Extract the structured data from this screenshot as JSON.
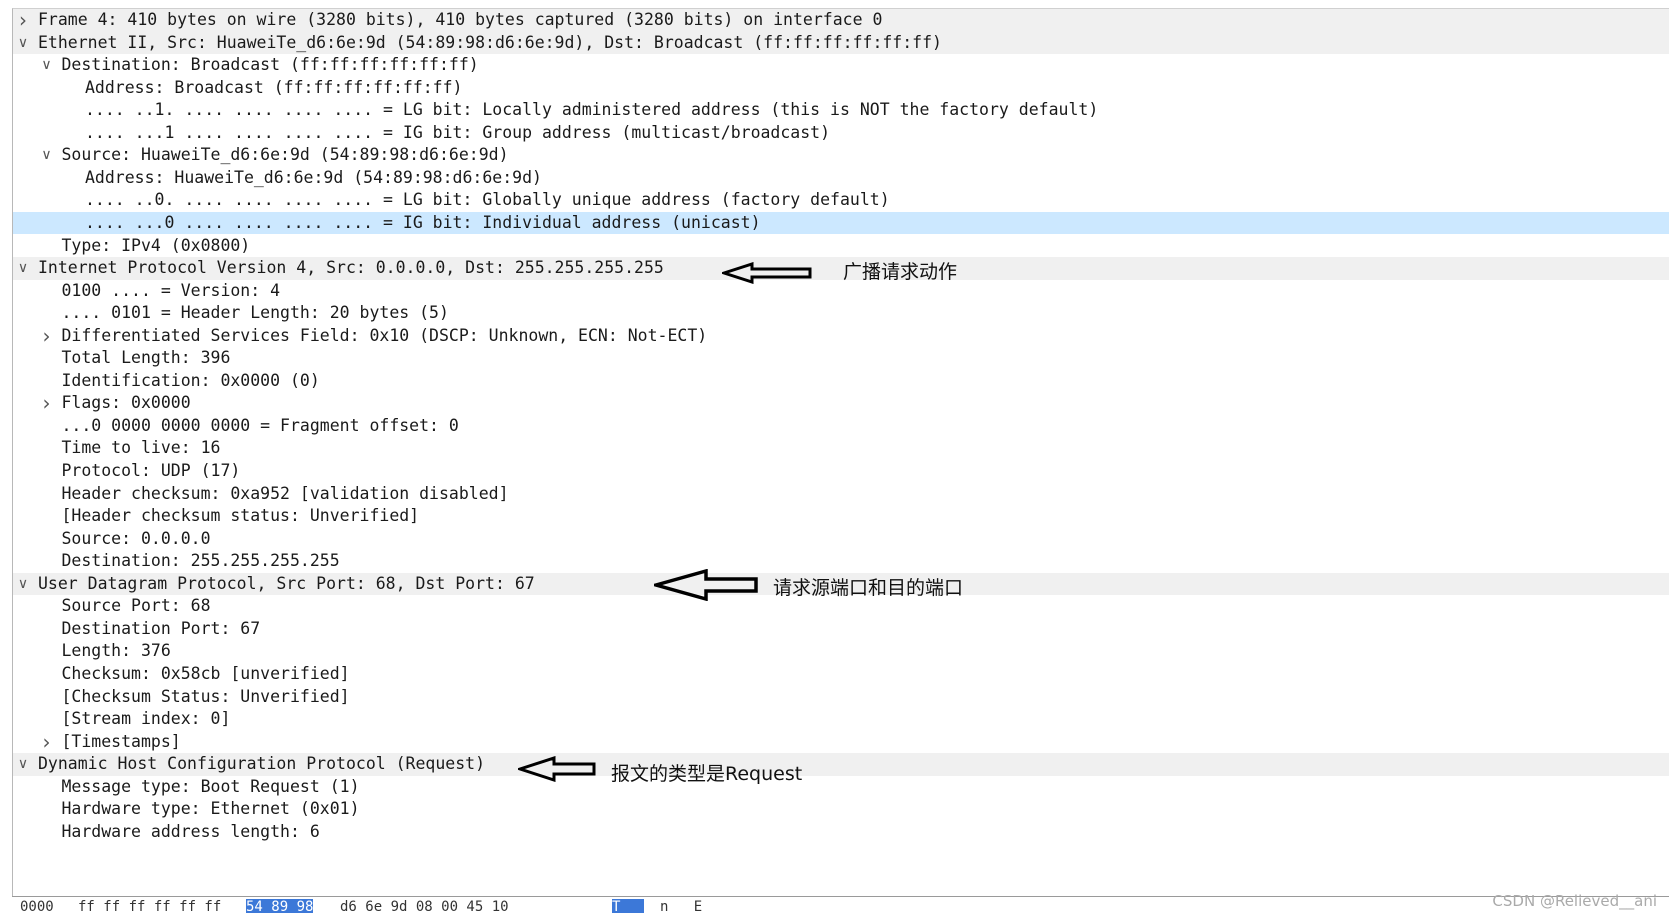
{
  "tree_rows": [
    {
      "text": "Frame 4: 410 bytes on wire (3280 bits), 410 bytes captured (3280 bits) on interface 0",
      "expander": "collapsed",
      "indent": 0,
      "top_level": true
    },
    {
      "text": "Ethernet II, Src: HuaweiTe_d6:6e:9d (54:89:98:d6:6e:9d), Dst: Broadcast (ff:ff:ff:ff:ff:ff)",
      "expander": "expanded",
      "indent": 0,
      "top_level": true
    },
    {
      "text": "Destination: Broadcast (ff:ff:ff:ff:ff:ff)",
      "expander": "expanded",
      "indent": 1
    },
    {
      "text": "Address: Broadcast (ff:ff:ff:ff:ff:ff)",
      "expander": "none",
      "indent": 2
    },
    {
      "text": ".... ..1. .... .... .... .... = LG bit: Locally administered address (this is NOT the factory default)",
      "expander": "none",
      "indent": 2
    },
    {
      "text": ".... ...1 .... .... .... .... = IG bit: Group address (multicast/broadcast)",
      "expander": "none",
      "indent": 2
    },
    {
      "text": "Source: HuaweiTe_d6:6e:9d (54:89:98:d6:6e:9d)",
      "expander": "expanded",
      "indent": 1
    },
    {
      "text": "Address: HuaweiTe_d6:6e:9d (54:89:98:d6:6e:9d)",
      "expander": "none",
      "indent": 2
    },
    {
      "text": ".... ..0. .... .... .... .... = LG bit: Globally unique address (factory default)",
      "expander": "none",
      "indent": 2
    },
    {
      "text": ".... ...0 .... .... .... .... = IG bit: Individual address (unicast)",
      "expander": "none",
      "indent": 2,
      "selected": true
    },
    {
      "text": "Type: IPv4 (0x0800)",
      "expander": "none",
      "indent": 1
    },
    {
      "text": "Internet Protocol Version 4, Src: 0.0.0.0, Dst: 255.255.255.255",
      "expander": "expanded",
      "indent": 0,
      "top_level": true
    },
    {
      "text": "0100 .... = Version: 4",
      "expander": "none",
      "indent": 1
    },
    {
      "text": ".... 0101 = Header Length: 20 bytes (5)",
      "expander": "none",
      "indent": 1
    },
    {
      "text": "Differentiated Services Field: 0x10 (DSCP: Unknown, ECN: Not-ECT)",
      "expander": "collapsed",
      "indent": 1
    },
    {
      "text": "Total Length: 396",
      "expander": "none",
      "indent": 1
    },
    {
      "text": "Identification: 0x0000 (0)",
      "expander": "none",
      "indent": 1
    },
    {
      "text": "Flags: 0x0000",
      "expander": "collapsed",
      "indent": 1
    },
    {
      "text": "...0 0000 0000 0000 = Fragment offset: 0",
      "expander": "none",
      "indent": 1
    },
    {
      "text": "Time to live: 16",
      "expander": "none",
      "indent": 1
    },
    {
      "text": "Protocol: UDP (17)",
      "expander": "none",
      "indent": 1
    },
    {
      "text": "Header checksum: 0xa952 [validation disabled]",
      "expander": "none",
      "indent": 1
    },
    {
      "text": "[Header checksum status: Unverified]",
      "expander": "none",
      "indent": 1
    },
    {
      "text": "Source: 0.0.0.0",
      "expander": "none",
      "indent": 1
    },
    {
      "text": "Destination: 255.255.255.255",
      "expander": "none",
      "indent": 1
    },
    {
      "text": "User Datagram Protocol, Src Port: 68, Dst Port: 67",
      "expander": "expanded",
      "indent": 0,
      "top_level": true
    },
    {
      "text": "Source Port: 68",
      "expander": "none",
      "indent": 1
    },
    {
      "text": "Destination Port: 67",
      "expander": "none",
      "indent": 1
    },
    {
      "text": "Length: 376",
      "expander": "none",
      "indent": 1
    },
    {
      "text": "Checksum: 0x58cb [unverified]",
      "expander": "none",
      "indent": 1
    },
    {
      "text": "[Checksum Status: Unverified]",
      "expander": "none",
      "indent": 1
    },
    {
      "text": "[Stream index: 0]",
      "expander": "none",
      "indent": 1
    },
    {
      "text": "[Timestamps]",
      "expander": "collapsed",
      "indent": 1
    },
    {
      "text": "Dynamic Host Configuration Protocol (Request)",
      "expander": "expanded",
      "indent": 0,
      "top_level": true
    },
    {
      "text": "Message type: Boot Request (1)",
      "expander": "none",
      "indent": 1
    },
    {
      "text": "Hardware type: Ethernet (0x01)",
      "expander": "none",
      "indent": 1
    },
    {
      "text": "Hardware address length: 6",
      "expander": "none",
      "indent": 1
    }
  ],
  "annotations": {
    "broadcast": "广播请求动作",
    "ports": "请求源端口和目的端口",
    "msg_type": "报文的类型是Request"
  },
  "hex_bar": {
    "offset": "0000",
    "bytes_before": "ff ff ff ff ff ff",
    "bytes_highlighted": "54 89 98",
    "bytes_after": "d6 6e 9d 08 00 45 10",
    "ascii_before": "",
    "ascii_highlighted": "T",
    "ascii_after": "n   E"
  },
  "watermark": "CSDN @Relieved__ani",
  "colors": {
    "selected_row": "#cce8ff",
    "top_level_row": "#f0f0f0",
    "hex_highlight": "#3c78d8"
  }
}
